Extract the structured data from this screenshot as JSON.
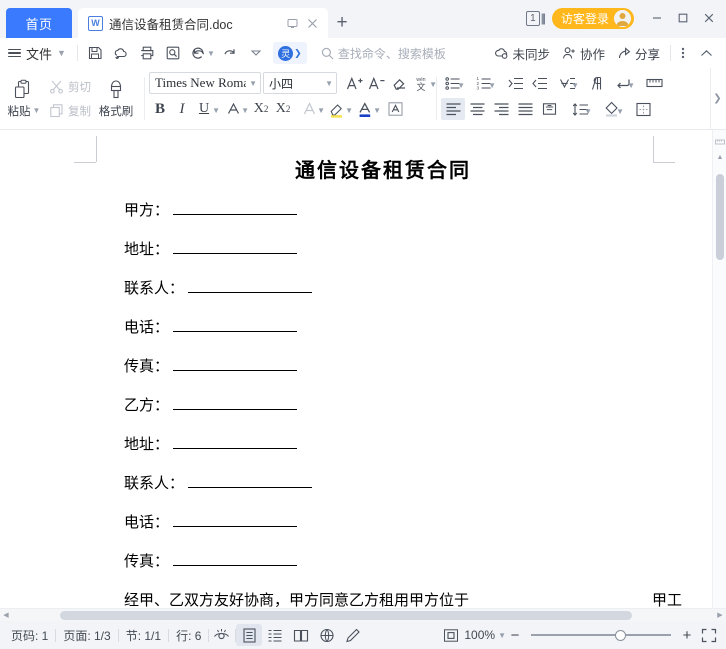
{
  "titlebar": {
    "home_tab": "首页",
    "doc_tab": {
      "icon": "wps-writer-icon",
      "name": "通信设备租赁合同.doc",
      "restore_icon": "restore-icon",
      "close_icon": "close-icon"
    },
    "new_tab_icon": "plus-icon",
    "page_count_badge": "1",
    "login_label": "访客登录",
    "avatar_icon": "user-avatar-icon",
    "minimize_icon": "minimize-icon",
    "maximize_icon": "maximize-icon",
    "close_icon": "close-icon"
  },
  "menurow": {
    "file_label": "文件",
    "quick": [
      "save-icon",
      "cloud-save-icon",
      "print-icon",
      "print-preview-icon",
      "undo-icon",
      "redo-icon",
      "customize-icon"
    ],
    "ai_button": "wps-ai-icon",
    "search_placeholder": "查找命令、搜索模板",
    "sync_label": "未同步",
    "collab_label": "协作",
    "share_label": "分享",
    "more_icon": "more-vertical-icon",
    "collapse_icon": "chevron-up-icon"
  },
  "ribbon": {
    "paste_label": "粘贴",
    "cut_label": "剪切",
    "copy_label": "复制",
    "format_painter_label": "格式刷",
    "font_name": "Times New Roma",
    "font_size": "小四",
    "font_tools": [
      "increase-font-icon",
      "decrease-font-icon",
      "clear-format-icon",
      "pinyin-guide-icon"
    ],
    "text_tools": [
      "bold-icon",
      "italic-icon",
      "underline-icon",
      "strikethrough-icon",
      "superscript-icon",
      "subscript-icon",
      "text-effects-icon",
      "highlight-icon",
      "font-color-icon",
      "character-border-icon"
    ],
    "para_tools_row1": [
      "bullets-icon",
      "numbering-icon",
      "decrease-indent-icon",
      "increase-indent-icon",
      "sort-icon",
      "show-marks-icon",
      "line-break-icon",
      "ruler-icon"
    ],
    "para_tools_row2": [
      "align-left-icon",
      "align-center-icon",
      "align-right-icon",
      "justify-icon",
      "distribute-icon",
      "line-spacing-icon",
      "shading-icon",
      "borders-icon"
    ],
    "expand_icon": "chevron-right-icon"
  },
  "document": {
    "title": "通信设备租赁合同",
    "fields": [
      {
        "label": "甲方："
      },
      {
        "label": "地址："
      },
      {
        "label": "联系人："
      },
      {
        "label": "电话："
      },
      {
        "label": "传真："
      },
      {
        "label": "乙方："
      },
      {
        "label": "地址："
      },
      {
        "label": "联系人："
      },
      {
        "label": "电话："
      },
      {
        "label": "传真："
      }
    ],
    "paragraph_left": "经甲、乙双方友好协商，甲方同意乙方租用甲方位于",
    "paragraph_right": "甲工"
  },
  "statusbar": {
    "page_number": "页码: 1",
    "page_of": "页面: 1/3",
    "section": "节: 1/1",
    "row": "行: 6",
    "eye_icon": "focus-mode-icon",
    "view_icons": [
      "page-view-icon",
      "outline-view-icon",
      "reading-view-icon",
      "web-view-icon",
      "markup-pen-icon"
    ],
    "fit_icon": "fit-page-icon",
    "zoom_level": "100%",
    "zoom_out_icon": "minus-icon",
    "zoom_in_icon": "plus-icon",
    "fullscreen_icon": "fullscreen-icon"
  },
  "colors": {
    "accent_blue": "#3a7afe",
    "login_orange": "#ffb71b",
    "chrome_bg": "#f2f4f7",
    "ai_blue": "#2f6fe0"
  }
}
